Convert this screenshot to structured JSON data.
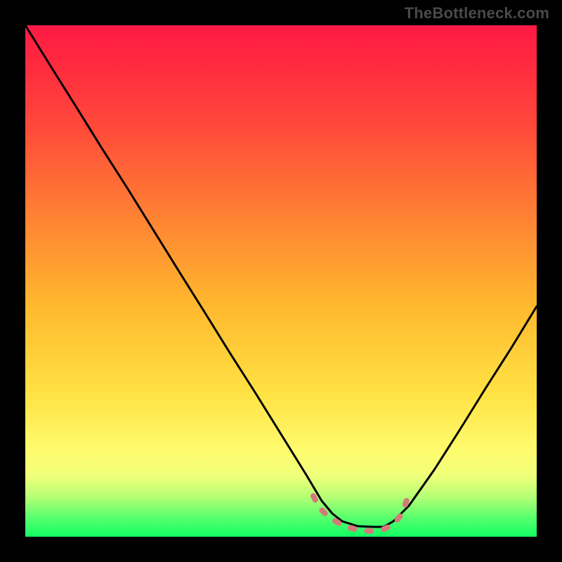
{
  "watermark": "TheBottleneck.com",
  "colors": {
    "background": "#000000",
    "gradient_top": "#ff1a44",
    "gradient_mid": "#ffe244",
    "gradient_bottom": "#12ff63",
    "curve_stroke": "#000000",
    "dash_stroke": "#d47a7a"
  },
  "chart_data": {
    "type": "line",
    "title": "",
    "xlabel": "",
    "ylabel": "",
    "xlim": [
      0,
      1
    ],
    "ylim": [
      0,
      1
    ],
    "series": [
      {
        "name": "bottleneck-curve",
        "x": [
          0.0,
          0.05,
          0.1,
          0.15,
          0.2,
          0.25,
          0.3,
          0.35,
          0.4,
          0.45,
          0.5,
          0.55,
          0.58,
          0.6,
          0.62,
          0.65,
          0.68,
          0.7,
          0.72,
          0.75,
          0.8,
          0.85,
          0.9,
          0.95,
          1.0
        ],
        "values": [
          1.0,
          0.92,
          0.84,
          0.76,
          0.68,
          0.6,
          0.52,
          0.44,
          0.36,
          0.28,
          0.2,
          0.12,
          0.07,
          0.05,
          0.03,
          0.02,
          0.02,
          0.02,
          0.03,
          0.06,
          0.13,
          0.21,
          0.29,
          0.37,
          0.45
        ]
      }
    ],
    "annotations": [
      {
        "name": "minimum-band",
        "type": "dashed-segment",
        "x_start": 0.56,
        "x_end": 0.74,
        "y": 0.04
      }
    ]
  }
}
